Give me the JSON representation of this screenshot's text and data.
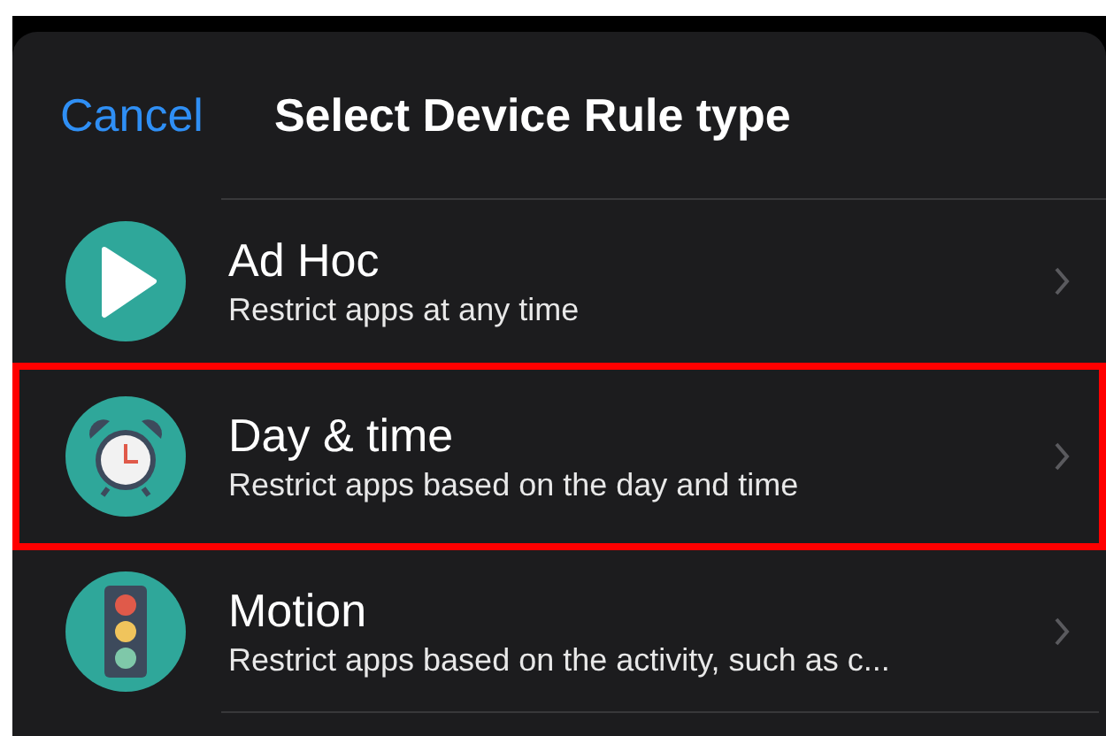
{
  "header": {
    "cancel": "Cancel",
    "title": "Select Device Rule type"
  },
  "rules": [
    {
      "kind": "play",
      "title": "Ad Hoc",
      "subtitle": "Restrict apps at any time",
      "highlighted": false
    },
    {
      "kind": "clock",
      "title": "Day & time",
      "subtitle": "Restrict apps based on the day and time",
      "highlighted": true
    },
    {
      "kind": "traffic",
      "title": "Motion",
      "subtitle": "Restrict apps based on the activity, such as c...",
      "highlighted": false
    }
  ]
}
